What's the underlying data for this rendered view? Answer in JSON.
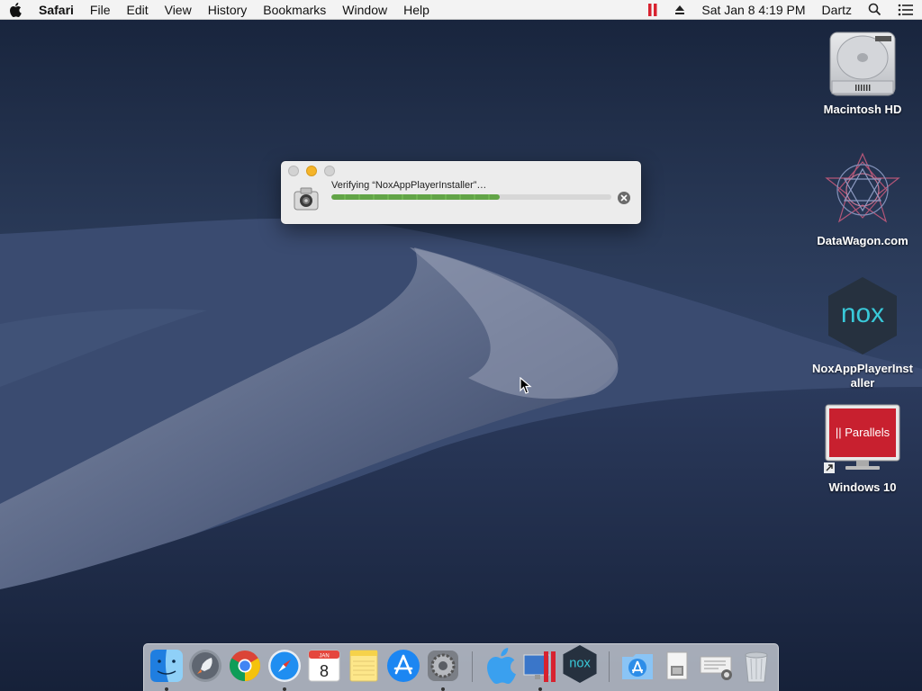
{
  "menubar": {
    "app_name": "Safari",
    "menus": [
      "File",
      "Edit",
      "View",
      "History",
      "Bookmarks",
      "Window",
      "Help"
    ],
    "clock": "Sat Jan 8  4:19 PM",
    "user": "Dartz"
  },
  "desktop_icons": [
    {
      "label": "Macintosh HD",
      "icon": "hard-drive-icon"
    },
    {
      "label": "DataWagon.com",
      "icon": "datawagon-icon"
    },
    {
      "label": "NoxAppPlayerInstaller",
      "icon": "nox-icon"
    },
    {
      "label": "Windows 10",
      "icon": "parallels-windows-icon"
    }
  ],
  "nox_logo_text": "nox",
  "parallels_text": "|| Parallels",
  "dialog": {
    "title": "Verifying “NoxAppPlayerInstaller”…",
    "progress": 0.6
  },
  "calendar": {
    "month": "JAN",
    "day": "8"
  },
  "dock_items": [
    {
      "name": "finder",
      "running": true
    },
    {
      "name": "launchpad",
      "running": false
    },
    {
      "name": "chrome",
      "running": false
    },
    {
      "name": "safari",
      "running": true
    },
    {
      "name": "calendar",
      "running": false
    },
    {
      "name": "notes",
      "running": false
    },
    {
      "name": "app-store",
      "running": false
    },
    {
      "name": "system-preferences",
      "running": true
    },
    {
      "name": "macos-installer",
      "running": false
    },
    {
      "name": "parallels",
      "running": true
    },
    {
      "name": "nox-player",
      "running": false
    },
    {
      "name": "applications-folder",
      "running": false
    },
    {
      "name": "documents",
      "running": false
    },
    {
      "name": "downloads",
      "running": false
    },
    {
      "name": "trash",
      "running": false
    }
  ],
  "colors": {
    "accent_progress": "#62a447",
    "parallels_red": "#c8202f",
    "nox_teal": "#39c9d9"
  }
}
